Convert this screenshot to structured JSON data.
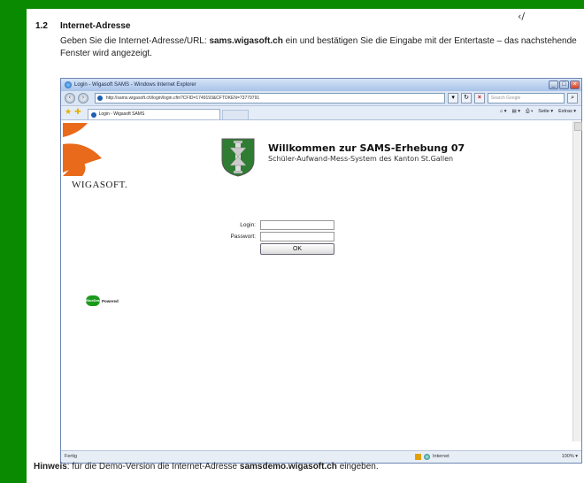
{
  "doc": {
    "corner_mark": "‹/",
    "section_number": "1.2",
    "section_title": "Internet-Adresse",
    "intro_pre": "Geben Sie die Internet-Adresse/URL: ",
    "intro_url": "sams.wigasoft.ch",
    "intro_post": " ein und bestätigen Sie die Eingabe mit der Entertaste – das nachstehende Fenster wird angezeigt.",
    "hint_label": "Hinweis",
    "hint_pre": ": für die Demo-Version die Internet-Adresse ",
    "hint_url": "samsdemo.wigasoft.ch",
    "hint_post": " eingeben."
  },
  "browser": {
    "title": "Login - Wigasoft SAMS - Windows Internet Explorer",
    "url": "http://sams.wigasoft.ch/login/login.cfm?CFID=1749193&CFTOKEN=73779791",
    "search_placeholder": "Search Google",
    "tab_label": "Login - Wigasoft SAMS",
    "tools": [
      "Seite ▾",
      "Extras ▾"
    ],
    "status_left": "Fertig",
    "status_zone": "Internet",
    "status_zoom": "100% ▾"
  },
  "site": {
    "brand": "WIGASOFT.",
    "welcome_title": "Willkommen zur SAMS-Erhebung 07",
    "welcome_subtitle": "Schüler-Aufwand-Mess-System des Kanton St.Gallen",
    "login_label": "Login:",
    "password_label": "Passwort:",
    "ok_label": "OK",
    "powered_badge": "BlueDragon",
    "powered_text": "Powered"
  },
  "colors": {
    "background": "#0a8a00",
    "crest": "#2e7d32",
    "wigasoft_orange": "#e86a1a"
  }
}
